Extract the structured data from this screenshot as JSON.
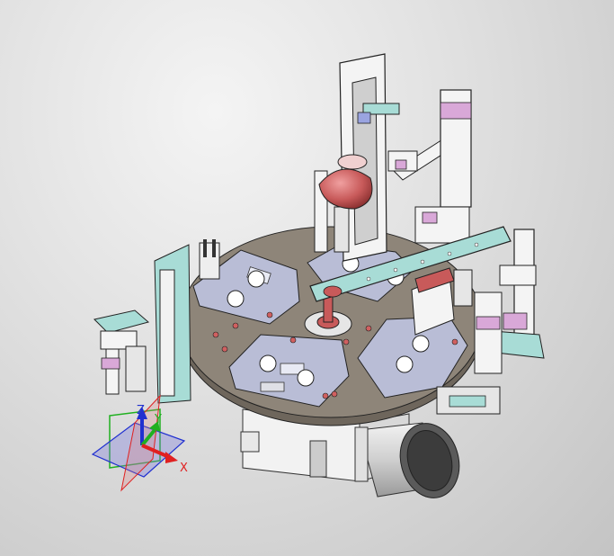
{
  "viewport": {
    "background_top": "#f0f0f0",
    "background_bottom": "#c6c6c6"
  },
  "triad": {
    "x_label": "X",
    "y_label": "Y",
    "z_label": "Z",
    "x_color": "#e02020",
    "y_color": "#20b020",
    "z_color": "#2030d0"
  },
  "model": {
    "plate_color": "#8e8579",
    "fixture_color": "#b9bdd6",
    "frame_color": "#f4f4f4",
    "arm_color": "#a8dcd6",
    "accent_color": "#d9a8d8",
    "part_color": "#c85a5a"
  }
}
